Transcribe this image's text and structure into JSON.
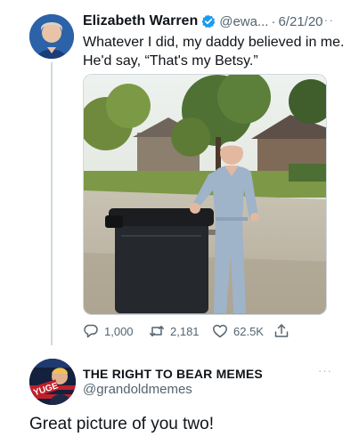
{
  "tweet": {
    "author_name": "Elizabeth Warren",
    "handle": "@ewa...",
    "separator": "·",
    "date": "6/21/20",
    "more": "···",
    "text": "Whatever I did, my daddy believed in me. He'd say, “That's my Betsy.”",
    "media_icon": "photo",
    "stats": {
      "replies": "1,000",
      "retweets": "2,181",
      "likes": "62.5K"
    },
    "icons": [
      "reply-icon",
      "retweet-icon",
      "like-icon",
      "share-icon",
      "verified-badge-icon"
    ],
    "colors": {
      "verified": "#1d9bf0",
      "secondary_text": "#536471",
      "thread_line": "#cfd9de"
    }
  },
  "reply": {
    "author_name": "THE RIGHT TO BEAR MEMES",
    "handle": "@grandoldmemes",
    "more": "···",
    "avatar_text": "YUGE",
    "text": "Great picture of you two!"
  }
}
